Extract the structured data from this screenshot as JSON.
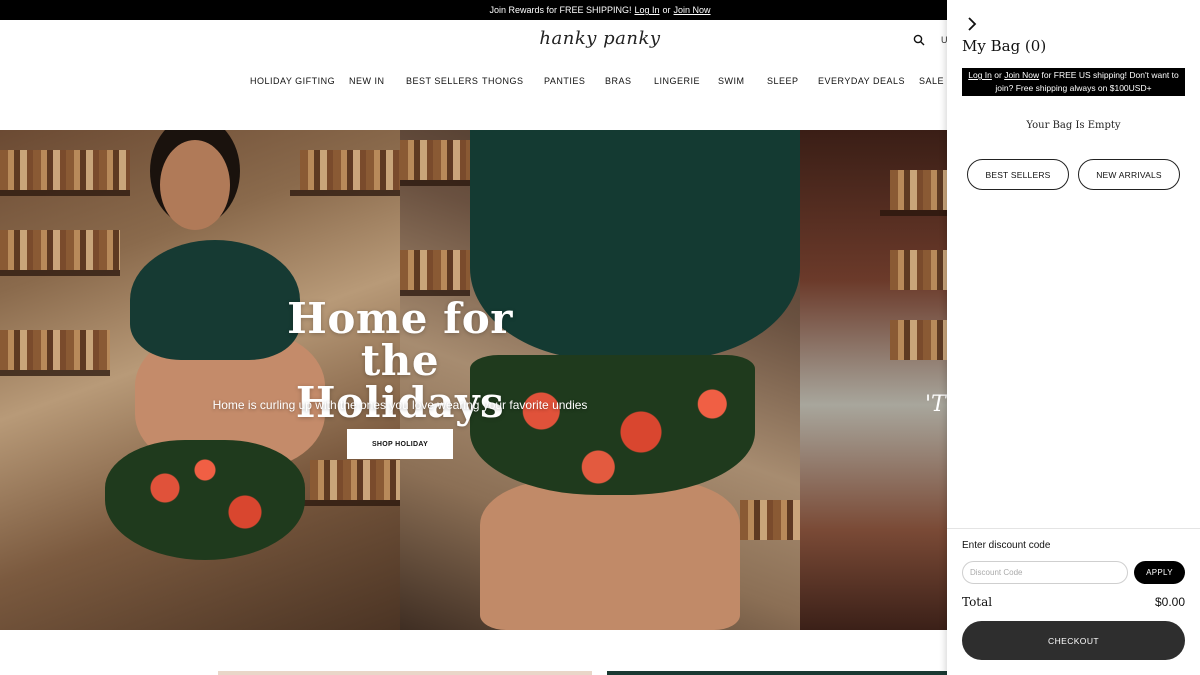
{
  "announcement": {
    "text": "Join Rewards for FREE SHIPPING!",
    "login_link": "Log In",
    "or_text": "or",
    "join_link": "Join Now"
  },
  "header": {
    "logo": "hanky panky",
    "search_icon": "search-icon",
    "user_icon": "user-icon"
  },
  "nav": {
    "items": [
      {
        "label": "HOLIDAY GIFTING"
      },
      {
        "label": "NEW IN"
      },
      {
        "label": "BEST SELLERS"
      },
      {
        "label": "THONGS"
      },
      {
        "label": "PANTIES"
      },
      {
        "label": "BRAS"
      },
      {
        "label": "LINGERIE"
      },
      {
        "label": "SWIM"
      },
      {
        "label": "SLEEP"
      },
      {
        "label": "EVERYDAY DEALS"
      },
      {
        "label": "SALE"
      }
    ]
  },
  "hero": {
    "title": "Home for the Holidays",
    "subtitle": "Home is curling up with the ones you love wearing your favorite undies",
    "cta_label": "SHOP HOLIDAY",
    "right_quote": "'T"
  },
  "cart": {
    "close_icon": "chevron-right-icon",
    "title": "My Bag (0)",
    "shipping_login": "Log In",
    "shipping_or": "or",
    "shipping_join": "Join Now",
    "shipping_text": "for FREE US shipping! Don't want to join? Free shipping always on $100USD+",
    "empty_message": "Your Bag Is Empty",
    "best_sellers_label": "BEST SELLERS",
    "new_arrivals_label": "NEW ARRIVALS",
    "discount_label": "Enter discount code",
    "discount_placeholder": "Discount Code",
    "apply_label": "APPLY",
    "total_label": "Total",
    "total_value": "$0.00",
    "checkout_label": "CHECKOUT"
  },
  "colors": {
    "announcement_bg": "#000000",
    "checkout_bg": "#2e2e2e",
    "accent_green": "#143a32",
    "accent_red": "#e0523a"
  }
}
